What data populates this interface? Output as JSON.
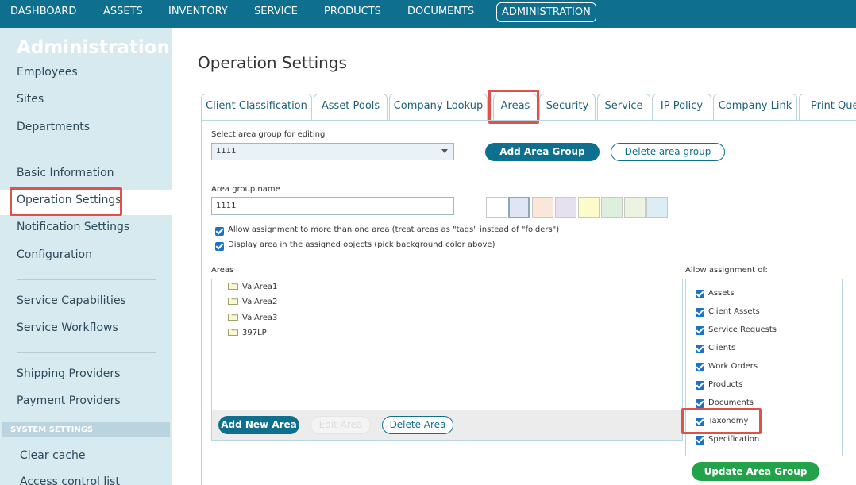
{
  "topnav": {
    "items": [
      "DASHBOARD",
      "ASSETS",
      "INVENTORY",
      "SERVICE",
      "PRODUCTS",
      "DOCUMENTS",
      "ADMINISTRATION"
    ],
    "active": "ADMINISTRATION",
    "color": "#0e6f8f"
  },
  "sidebar": {
    "heading": "Administration",
    "items": [
      "Employees",
      "Sites",
      "Departments",
      "Basic Information",
      "Operation Settings",
      "Notification Settings",
      "Configuration",
      "Service Capabilities",
      "Service Workflows",
      "Shipping Providers",
      "Payment Providers"
    ],
    "active": "Operation Settings",
    "section_label": "SYSTEM SETTINGS",
    "sub_items": [
      "Clear cache",
      "Access control list"
    ]
  },
  "page": {
    "title": "Operation Settings",
    "tabs": [
      "Client Classification",
      "Asset Pools",
      "Company Lookup",
      "Areas",
      "Security",
      "Service",
      "IP Policy",
      "Company Link",
      "Print Queue"
    ],
    "active_tab": "Areas"
  },
  "form": {
    "select_label": "Select area group for editing",
    "select_value": "1111",
    "add_group_label": "Add Area Group",
    "delete_group_label": "Delete area group",
    "group_name_label": "Area group name",
    "group_name_value": "1111",
    "swatch_colors": [
      "#ffffff",
      "#dfe5f5",
      "#fbe7da",
      "#e6e1ef",
      "#fdfbc9",
      "#dcf0dc",
      "#edf3e1",
      "#dceef3"
    ],
    "option_tags": "Allow assignment to more than one area (treat areas as \"tags\" instead of \"folders\")",
    "option_display": "Display area in the assigned objects (pick background color above)",
    "areas_label": "Areas",
    "areas": [
      "ValArea1",
      "ValArea2",
      "ValArea3",
      "397LP"
    ],
    "add_area_label": "Add New Area",
    "edit_area_label": "Edit Area",
    "delete_area_label": "Delete Area",
    "assign_label": "Allow assignment of:",
    "assign_items": [
      "Assets",
      "Client Assets",
      "Service Requests",
      "Clients",
      "Work Orders",
      "Products",
      "Documents",
      "Taxonomy",
      "Specification"
    ],
    "update_label": "Update Area Group"
  },
  "icons": {
    "folder": "folder-icon",
    "checkbox": "checkbox-checked-icon",
    "caret": "chevron-down-icon"
  },
  "colors": {
    "accent": "#0e6f8f",
    "highlight": "#e0514a",
    "update_button": "#22a34a",
    "checkbox": "#1a73c8"
  }
}
